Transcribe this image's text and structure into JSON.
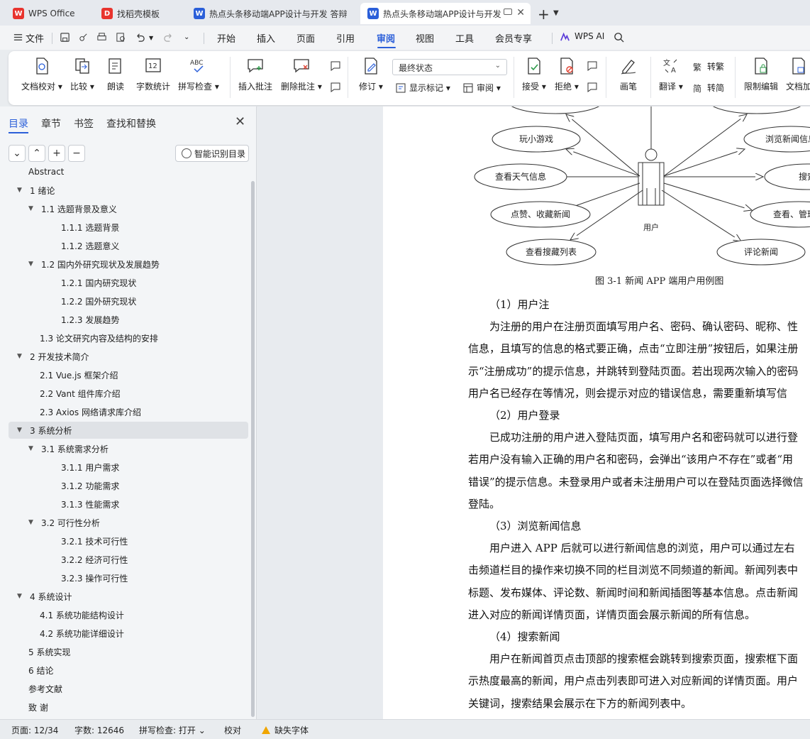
{
  "tabs": [
    {
      "label": "WPS Office",
      "icon": "wps-logo-icon"
    },
    {
      "label": "找稻壳模板",
      "icon": "docer-icon"
    },
    {
      "label": "热点头条移动端APP设计与开发 答辩",
      "icon": "word-doc-icon"
    },
    {
      "label": "热点头条移动端APP设计与开发",
      "icon": "word-doc-icon"
    }
  ],
  "menu": {
    "file": "文件",
    "items": [
      "开始",
      "插入",
      "页面",
      "引用",
      "审阅",
      "视图",
      "工具",
      "会员专享"
    ],
    "active": "审阅",
    "wps_ai": "WPS AI"
  },
  "ribbon": {
    "doc_check": "文档校对",
    "compare": "比较",
    "read_aloud": "朗读",
    "word_count": "字数统计",
    "spell_check": "拼写检查",
    "insert_comment": "插入批注",
    "delete_comment": "删除批注",
    "revise": "修订",
    "final_state": "最终状态",
    "show_markup": "显示标记",
    "review": "审阅",
    "accept": "接受",
    "reject": "拒绝",
    "pen": "画笔",
    "translate": "翻译",
    "to_traditional": "转繁",
    "to_simplified": "转简",
    "restrict_edit": "限制编辑",
    "doc_more": "文档加"
  },
  "panel": {
    "tabs": [
      "目录",
      "章节",
      "书签",
      "查找和替换"
    ],
    "smart_toc": "智能识别目录",
    "toc": [
      {
        "label": "Abstract",
        "level": 1,
        "caret": ""
      },
      {
        "label": "1  绪论",
        "level": 1,
        "caret": "▼"
      },
      {
        "label": "1.1  选题背景及意义",
        "level": 2,
        "caret": "▼"
      },
      {
        "label": "1.1.1  选题背景",
        "level": 3,
        "caret": ""
      },
      {
        "label": "1.1.2  选题意义",
        "level": 3,
        "caret": ""
      },
      {
        "label": "1.2  国内外研究现状及发展趋势",
        "level": 2,
        "caret": "▼"
      },
      {
        "label": "1.2.1  国内研究现状",
        "level": 3,
        "caret": ""
      },
      {
        "label": "1.2.2  国外研究现状",
        "level": 3,
        "caret": ""
      },
      {
        "label": "1.2.3  发展趋势",
        "level": 3,
        "caret": ""
      },
      {
        "label": "1.3 论文研究内容及结构的安排",
        "level": 2,
        "caret": ""
      },
      {
        "label": "2  开发技术简介",
        "level": 1,
        "caret": "▼"
      },
      {
        "label": "2.1 Vue.js 框架介绍",
        "level": 2,
        "caret": ""
      },
      {
        "label": "2.2 Vant 组件库介绍",
        "level": 2,
        "caret": ""
      },
      {
        "label": "2.3 Axios 网络请求库介绍",
        "level": 2,
        "caret": ""
      },
      {
        "label": "3  系统分析",
        "level": 1,
        "caret": "▼"
      },
      {
        "label": "3.1  系统需求分析",
        "level": 2,
        "caret": "▼"
      },
      {
        "label": "3.1.1  用户需求",
        "level": 3,
        "caret": ""
      },
      {
        "label": "3.1.2  功能需求",
        "level": 3,
        "caret": ""
      },
      {
        "label": "3.1.3  性能需求",
        "level": 3,
        "caret": ""
      },
      {
        "label": "3.2  可行性分析",
        "level": 2,
        "caret": "▼"
      },
      {
        "label": "3.2.1  技术可行性",
        "level": 3,
        "caret": ""
      },
      {
        "label": "3.2.2  经济可行性",
        "level": 3,
        "caret": ""
      },
      {
        "label": "3.2.3  操作可行性",
        "level": 3,
        "caret": ""
      },
      {
        "label": "4  系统设计",
        "level": 1,
        "caret": "▼"
      },
      {
        "label": "4.1  系统功能结构设计",
        "level": 2,
        "caret": ""
      },
      {
        "label": "4.2  系统功能详细设计",
        "level": 2,
        "caret": ""
      },
      {
        "label": "5  系统实现",
        "level": 1,
        "caret": ""
      },
      {
        "label": "6  结论",
        "level": 1,
        "caret": ""
      },
      {
        "label": "参考文献",
        "level": 1,
        "caret": ""
      },
      {
        "label": "致    谢",
        "level": 1,
        "caret": ""
      }
    ],
    "selected": "3  系统分析"
  },
  "diagram": {
    "actor": "用户",
    "use_cases": [
      "玩小游戏",
      "查看天气信息",
      "点赞、收藏新闻",
      "查看搜藏列表",
      "浏览新闻信息",
      "搜索",
      "查看、管理个",
      "评论新闻"
    ],
    "caption": "图 3-1   新闻 APP 端用户用例图"
  },
  "document": {
    "lines": [
      "（1）用户注",
      "为注册的用户在注册页面填写用户名、密码、确认密码、昵称、性",
      "信息，且填写的信息的格式要正确，点击“立即注册”按钮后，如果注册",
      "示“注册成功”的提示信息，并跳转到登陆页面。若出现两次输入的密码",
      "用户名已经存在等情况，则会提示对应的错误信息，需要重新填写信",
      "（2）用户登录",
      "已成功注册的用户进入登陆页面，填写用户名和密码就可以进行登",
      "若用户没有输入正确的用户名和密码，会弹出“该用户不存在”或者“用",
      "错误”的提示信息。未登录用户或者未注册用户可以在登陆页面选择微信",
      "登陆。",
      "（3）浏览新闻信息",
      "用户进入 APP 后就可以进行新闻信息的浏览，用户可以通过左右",
      "击频道栏目的操作来切换不同的栏目浏览不同频道的新闻。新闻列表中",
      "标题、发布媒体、评论数、新闻时间和新闻插图等基本信息。点击新闻",
      "进入对应的新闻详情页面，详情页面会展示新闻的所有信息。",
      "（4）搜索新闻",
      "用户在新闻首页点击顶部的搜索框会跳转到搜索页面，搜索框下面",
      "示热度最高的新闻，用户点击列表即可进入对应新闻的详情页面。用户",
      "关键词，搜索结果会展示在下方的新闻列表中。"
    ]
  },
  "status": {
    "page": "页面: 12/34",
    "words": "字数: 12646",
    "spell": "拼写检查: 打开",
    "proof": "校对",
    "missing_font": "缺失字体"
  },
  "colors": {
    "accent": "#2b5fd9",
    "wps_red": "#e8342e",
    "warning": "#f0a500"
  }
}
